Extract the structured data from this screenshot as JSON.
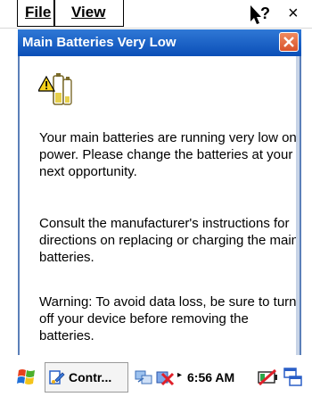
{
  "menubar": {
    "file_label": "File",
    "view_label": "View",
    "help_icon": "help-pointer-icon",
    "close_glyph": "×"
  },
  "dialog": {
    "title": "Main Batteries Very Low",
    "icon": "battery-warning-icon",
    "paragraphs": [
      "Your main batteries are running very low on power. Please change the batteries at your next opportunity.",
      "Consult the manufacturer's instructions for directions on replacing or charging the main batteries.",
      "Warning: To avoid data loss, be sure to turn off your device before removing the batteries."
    ]
  },
  "taskbar": {
    "task_label": "Contr...",
    "tray_arrow": "▸",
    "clock": "6:56 AM"
  },
  "colors": {
    "title_bar": "#1a5fc7",
    "close_button": "#e2653a"
  }
}
